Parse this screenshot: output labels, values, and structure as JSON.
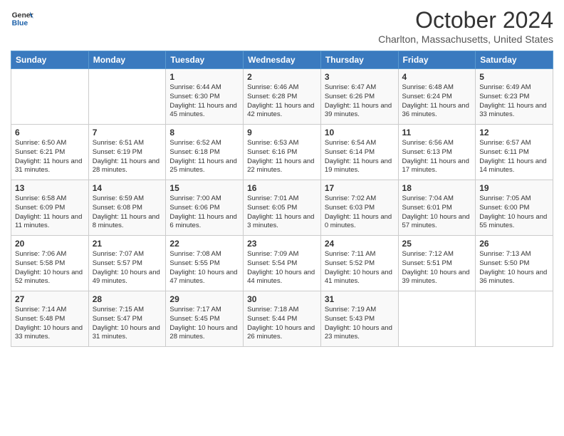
{
  "header": {
    "logo_line1": "General",
    "logo_line2": "Blue",
    "month": "October 2024",
    "location": "Charlton, Massachusetts, United States"
  },
  "days_of_week": [
    "Sunday",
    "Monday",
    "Tuesday",
    "Wednesday",
    "Thursday",
    "Friday",
    "Saturday"
  ],
  "weeks": [
    [
      {
        "day": "",
        "sunrise": "",
        "sunset": "",
        "daylight": ""
      },
      {
        "day": "",
        "sunrise": "",
        "sunset": "",
        "daylight": ""
      },
      {
        "day": "1",
        "sunrise": "Sunrise: 6:44 AM",
        "sunset": "Sunset: 6:30 PM",
        "daylight": "Daylight: 11 hours and 45 minutes."
      },
      {
        "day": "2",
        "sunrise": "Sunrise: 6:46 AM",
        "sunset": "Sunset: 6:28 PM",
        "daylight": "Daylight: 11 hours and 42 minutes."
      },
      {
        "day": "3",
        "sunrise": "Sunrise: 6:47 AM",
        "sunset": "Sunset: 6:26 PM",
        "daylight": "Daylight: 11 hours and 39 minutes."
      },
      {
        "day": "4",
        "sunrise": "Sunrise: 6:48 AM",
        "sunset": "Sunset: 6:24 PM",
        "daylight": "Daylight: 11 hours and 36 minutes."
      },
      {
        "day": "5",
        "sunrise": "Sunrise: 6:49 AM",
        "sunset": "Sunset: 6:23 PM",
        "daylight": "Daylight: 11 hours and 33 minutes."
      }
    ],
    [
      {
        "day": "6",
        "sunrise": "Sunrise: 6:50 AM",
        "sunset": "Sunset: 6:21 PM",
        "daylight": "Daylight: 11 hours and 31 minutes."
      },
      {
        "day": "7",
        "sunrise": "Sunrise: 6:51 AM",
        "sunset": "Sunset: 6:19 PM",
        "daylight": "Daylight: 11 hours and 28 minutes."
      },
      {
        "day": "8",
        "sunrise": "Sunrise: 6:52 AM",
        "sunset": "Sunset: 6:18 PM",
        "daylight": "Daylight: 11 hours and 25 minutes."
      },
      {
        "day": "9",
        "sunrise": "Sunrise: 6:53 AM",
        "sunset": "Sunset: 6:16 PM",
        "daylight": "Daylight: 11 hours and 22 minutes."
      },
      {
        "day": "10",
        "sunrise": "Sunrise: 6:54 AM",
        "sunset": "Sunset: 6:14 PM",
        "daylight": "Daylight: 11 hours and 19 minutes."
      },
      {
        "day": "11",
        "sunrise": "Sunrise: 6:56 AM",
        "sunset": "Sunset: 6:13 PM",
        "daylight": "Daylight: 11 hours and 17 minutes."
      },
      {
        "day": "12",
        "sunrise": "Sunrise: 6:57 AM",
        "sunset": "Sunset: 6:11 PM",
        "daylight": "Daylight: 11 hours and 14 minutes."
      }
    ],
    [
      {
        "day": "13",
        "sunrise": "Sunrise: 6:58 AM",
        "sunset": "Sunset: 6:09 PM",
        "daylight": "Daylight: 11 hours and 11 minutes."
      },
      {
        "day": "14",
        "sunrise": "Sunrise: 6:59 AM",
        "sunset": "Sunset: 6:08 PM",
        "daylight": "Daylight: 11 hours and 8 minutes."
      },
      {
        "day": "15",
        "sunrise": "Sunrise: 7:00 AM",
        "sunset": "Sunset: 6:06 PM",
        "daylight": "Daylight: 11 hours and 6 minutes."
      },
      {
        "day": "16",
        "sunrise": "Sunrise: 7:01 AM",
        "sunset": "Sunset: 6:05 PM",
        "daylight": "Daylight: 11 hours and 3 minutes."
      },
      {
        "day": "17",
        "sunrise": "Sunrise: 7:02 AM",
        "sunset": "Sunset: 6:03 PM",
        "daylight": "Daylight: 11 hours and 0 minutes."
      },
      {
        "day": "18",
        "sunrise": "Sunrise: 7:04 AM",
        "sunset": "Sunset: 6:01 PM",
        "daylight": "Daylight: 10 hours and 57 minutes."
      },
      {
        "day": "19",
        "sunrise": "Sunrise: 7:05 AM",
        "sunset": "Sunset: 6:00 PM",
        "daylight": "Daylight: 10 hours and 55 minutes."
      }
    ],
    [
      {
        "day": "20",
        "sunrise": "Sunrise: 7:06 AM",
        "sunset": "Sunset: 5:58 PM",
        "daylight": "Daylight: 10 hours and 52 minutes."
      },
      {
        "day": "21",
        "sunrise": "Sunrise: 7:07 AM",
        "sunset": "Sunset: 5:57 PM",
        "daylight": "Daylight: 10 hours and 49 minutes."
      },
      {
        "day": "22",
        "sunrise": "Sunrise: 7:08 AM",
        "sunset": "Sunset: 5:55 PM",
        "daylight": "Daylight: 10 hours and 47 minutes."
      },
      {
        "day": "23",
        "sunrise": "Sunrise: 7:09 AM",
        "sunset": "Sunset: 5:54 PM",
        "daylight": "Daylight: 10 hours and 44 minutes."
      },
      {
        "day": "24",
        "sunrise": "Sunrise: 7:11 AM",
        "sunset": "Sunset: 5:52 PM",
        "daylight": "Daylight: 10 hours and 41 minutes."
      },
      {
        "day": "25",
        "sunrise": "Sunrise: 7:12 AM",
        "sunset": "Sunset: 5:51 PM",
        "daylight": "Daylight: 10 hours and 39 minutes."
      },
      {
        "day": "26",
        "sunrise": "Sunrise: 7:13 AM",
        "sunset": "Sunset: 5:50 PM",
        "daylight": "Daylight: 10 hours and 36 minutes."
      }
    ],
    [
      {
        "day": "27",
        "sunrise": "Sunrise: 7:14 AM",
        "sunset": "Sunset: 5:48 PM",
        "daylight": "Daylight: 10 hours and 33 minutes."
      },
      {
        "day": "28",
        "sunrise": "Sunrise: 7:15 AM",
        "sunset": "Sunset: 5:47 PM",
        "daylight": "Daylight: 10 hours and 31 minutes."
      },
      {
        "day": "29",
        "sunrise": "Sunrise: 7:17 AM",
        "sunset": "Sunset: 5:45 PM",
        "daylight": "Daylight: 10 hours and 28 minutes."
      },
      {
        "day": "30",
        "sunrise": "Sunrise: 7:18 AM",
        "sunset": "Sunset: 5:44 PM",
        "daylight": "Daylight: 10 hours and 26 minutes."
      },
      {
        "day": "31",
        "sunrise": "Sunrise: 7:19 AM",
        "sunset": "Sunset: 5:43 PM",
        "daylight": "Daylight: 10 hours and 23 minutes."
      },
      {
        "day": "",
        "sunrise": "",
        "sunset": "",
        "daylight": ""
      },
      {
        "day": "",
        "sunrise": "",
        "sunset": "",
        "daylight": ""
      }
    ]
  ]
}
